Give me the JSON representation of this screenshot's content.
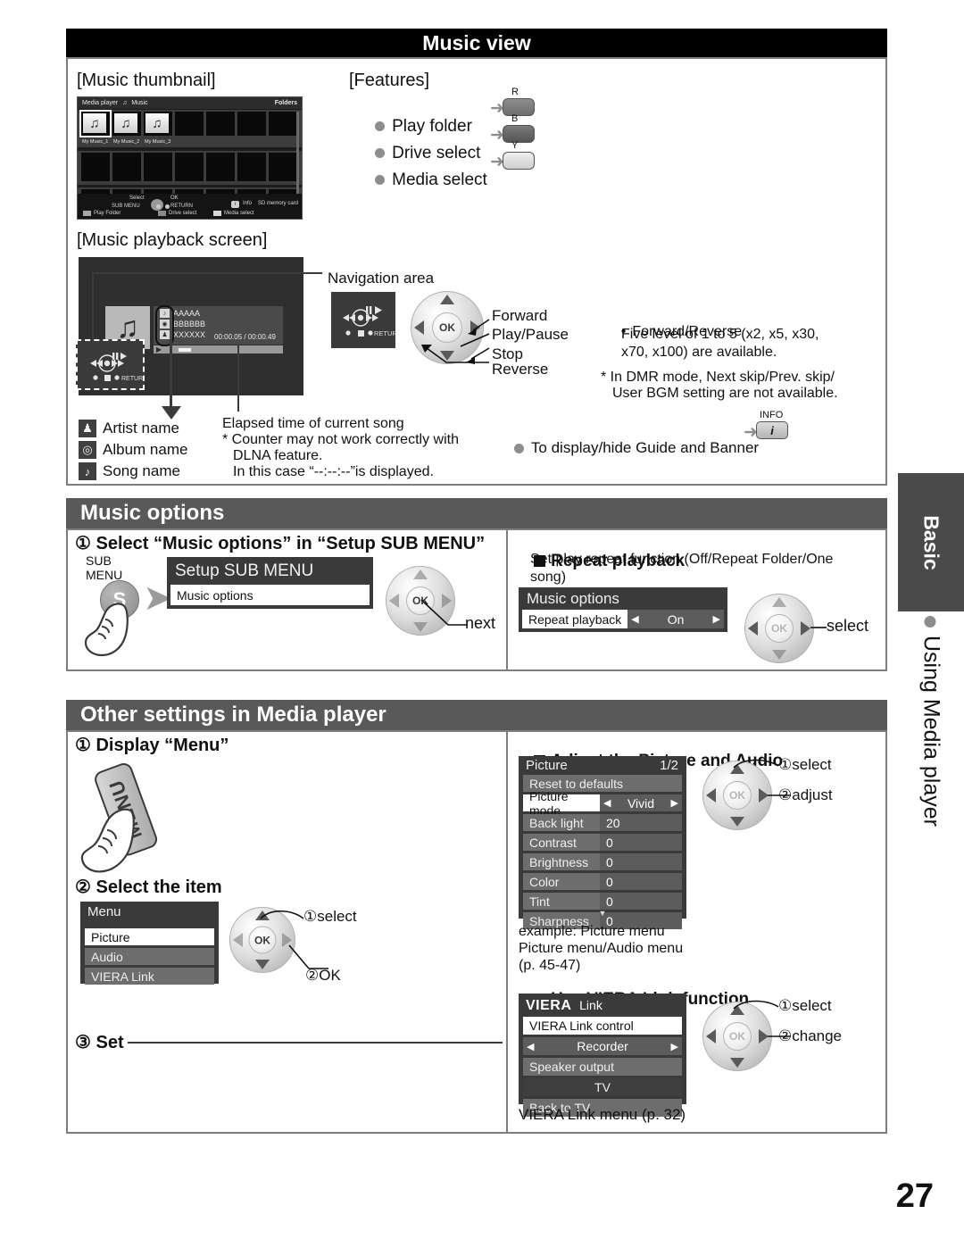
{
  "page": {
    "number": "27"
  },
  "side_tab": {
    "label": "Basic",
    "caption": "Using Media player"
  },
  "music_view": {
    "header": "Music view",
    "thumbnail_caption": "[Music thumbnail]",
    "playback_caption": "[Music playback screen]",
    "features": {
      "caption": "[Features]",
      "items": [
        {
          "label": "Play folder",
          "key": "R",
          "arrow": "➜"
        },
        {
          "label": "Drive select",
          "key": "B",
          "arrow": "➜"
        },
        {
          "label": "Media select",
          "key": "Y",
          "arrow": "➜"
        }
      ]
    },
    "thumb_screen": {
      "app": "Media player",
      "note_icon": "♫",
      "mode": "Music",
      "folders": "Folders",
      "tiles": [
        {
          "label": "My Music_1",
          "selected": true
        },
        {
          "label": "My Music_2",
          "selected": false
        },
        {
          "label": "My Music_3",
          "selected": false
        }
      ],
      "guide": {
        "select": "Select",
        "ok": "OK",
        "sub_menu": "SUB MENU",
        "return": "RETURN",
        "info": "Info",
        "memory": "SD memory card",
        "play_folder": "Play Folder",
        "drive_select": "Drive select",
        "media_select": "Media select"
      }
    },
    "playback_screen": {
      "song": "AAAAA",
      "album": "BBBBBB",
      "artist": "XXXXXX",
      "time": "00:00.05 / 00:00.49",
      "nav_return": "RETURN"
    },
    "navigation_label": "Navigation area",
    "dpad_labels": {
      "forward": "Forward",
      "play_pause": "Play/Pause",
      "stop": "Stop",
      "reverse": "Reverse",
      "ok": "OK"
    },
    "notes_right": {
      "bullet_title": "Forward/Reverse",
      "bullet_body_1": "Five level of 1 to 5 (x2, x5, x30,",
      "bullet_body_2": "x70, x100) are available.",
      "star_1": "* In DMR mode, Next skip/Prev. skip/",
      "star_2": "User BGM setting are not available."
    },
    "legend": [
      {
        "icon": "♟",
        "label": "Artist name"
      },
      {
        "icon": "◎",
        "label": "Album name"
      },
      {
        "icon": "♪",
        "label": "Song name"
      }
    ],
    "elapsed_notes": {
      "title": "Elapsed time of current song",
      "l1": "* Counter may not work correctly with",
      "l2": "DLNA feature.",
      "l3": "In this case “--:--:--”is displayed."
    },
    "guide_banner": {
      "text": "To display/hide Guide and Banner",
      "arrow": "➜",
      "key_top": "INFO",
      "key_glyph": "i"
    }
  },
  "music_options": {
    "header": "Music options",
    "step1": "① Select “Music options” in “Setup SUB MENU”",
    "sub_key_line1": "SUB",
    "sub_key_line2": "MENU",
    "sub_key_glyph": "S",
    "submenu": {
      "title": "Setup SUB MENU",
      "row": "Music options"
    },
    "next_label": "next",
    "repeat": {
      "title": "Repeat playback",
      "desc_1": "Set play repeat function (Off/Repeat Folder/One",
      "desc_2": "song)",
      "osd_title": "Music options",
      "osd_label": "Repeat playback",
      "osd_value": "On",
      "select_label": "select"
    }
  },
  "other_settings": {
    "header": "Other settings in Media player",
    "step1": "① Display “Menu”",
    "menu_key_label": "MENU",
    "step2": "② Select the item",
    "menu": {
      "title": "Menu",
      "rows": [
        {
          "label": "Picture",
          "style": "white"
        },
        {
          "label": "Audio",
          "style": "gray"
        },
        {
          "label": "VIERA Link",
          "style": "gray"
        }
      ],
      "hint_1": "①select",
      "hint_2": "②OK"
    },
    "step3": "③ Set",
    "picture_audio": {
      "title": "Adjust the Picture and Audio",
      "osd_title": "Picture",
      "osd_page": "1/2",
      "rows": [
        {
          "label": "Reset to defaults",
          "value": "",
          "type": "full-gray"
        },
        {
          "label": "Picture mode",
          "value": "Vivid",
          "type": "selected-arrows"
        },
        {
          "label": "Back light",
          "value": "20",
          "type": "pair"
        },
        {
          "label": "Contrast",
          "value": "0",
          "type": "pair"
        },
        {
          "label": "Brightness",
          "value": "0",
          "type": "pair"
        },
        {
          "label": "Color",
          "value": "0",
          "type": "pair"
        },
        {
          "label": "Tint",
          "value": "0",
          "type": "pair"
        },
        {
          "label": "Sharpness",
          "value": "0",
          "type": "pair"
        }
      ],
      "hint_1": "①select",
      "hint_2": "②adjust",
      "caption_1": "example: Picture menu",
      "caption_2": "Picture menu/Audio menu",
      "caption_3": "(p. 45-47)"
    },
    "viera_link": {
      "title": "Use VIERA Link function",
      "logo_1": "VIERA",
      "logo_2": "Link",
      "rows": [
        {
          "label": "VIERA Link control",
          "style": "white"
        },
        {
          "label": "Recorder",
          "style": "value-arrows"
        },
        {
          "label": "Speaker output",
          "style": "gray"
        },
        {
          "label": "TV",
          "style": "value-dark"
        },
        {
          "label": "Back to TV",
          "style": "gray"
        }
      ],
      "hint_1": "①select",
      "hint_2": "②change",
      "caption": "VIERA Link menu (p. 32)"
    }
  }
}
